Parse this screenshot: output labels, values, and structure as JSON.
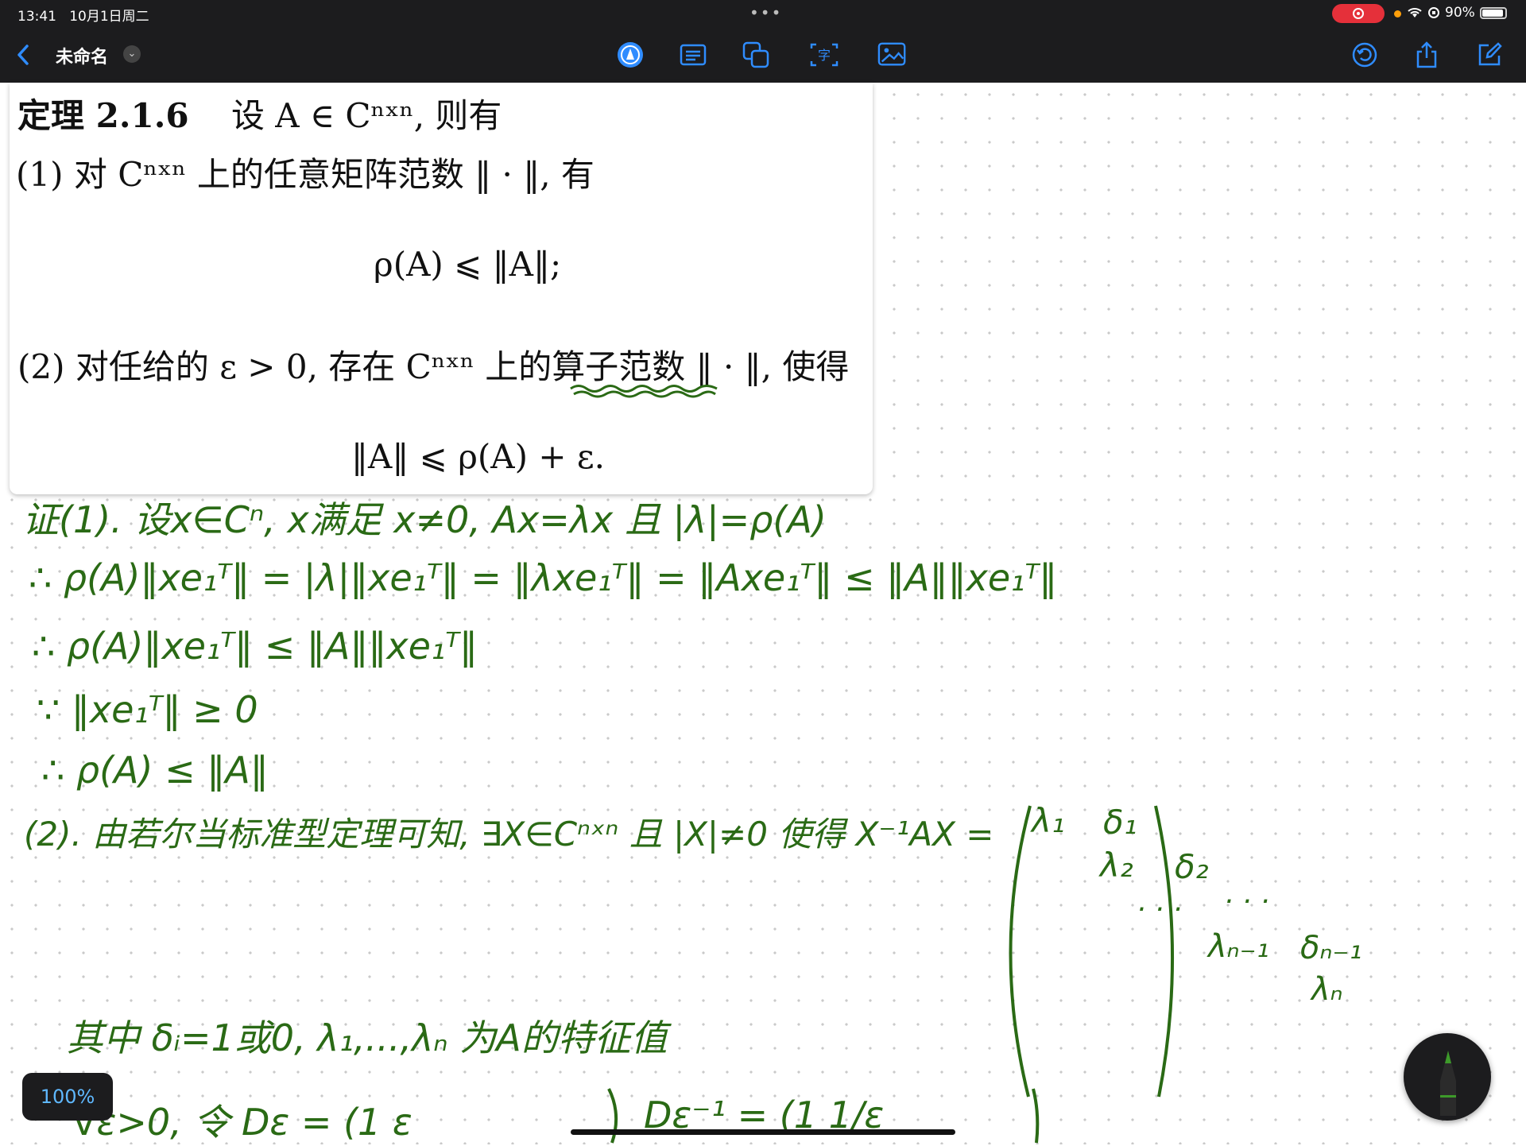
{
  "status": {
    "time": "13:41",
    "date": "10月1日周二",
    "battery": "90%"
  },
  "nav": {
    "title": "未命名",
    "icons": [
      "back-icon",
      "title-menu-icon",
      "pen-tool-icon",
      "text-box-icon",
      "shapes-icon",
      "text-recognition-icon",
      "image-icon",
      "undo-icon",
      "share-icon",
      "edit-icon"
    ]
  },
  "accent": "#2f8cff",
  "ink_color": "#2a6a15",
  "theorem": {
    "title": "定理 2.1.6",
    "intro": "设 A ∈ Cⁿˣⁿ, 则有",
    "item1": "(1) 对 Cⁿˣⁿ 上的任意矩阵范数 ‖ · ‖, 有",
    "formula1": "ρ(A) ⩽ ‖A‖;",
    "item2_pre": "(2) 对任给的 ε > 0, 存在 Cⁿˣⁿ 上的",
    "item2_mark": "算子范数",
    "item2_post": "‖ · ‖, 使得",
    "formula2": "‖A‖ ⩽ ρ(A) + ε."
  },
  "handwriting": {
    "l1": "证(1). 设x∈Cⁿ, x满足 x≠0, Ax=λx 且 |λ|=ρ(A)",
    "l2": "∴ ρ(A)‖xe₁ᵀ‖ = |λ|‖xe₁ᵀ‖ = ‖λxe₁ᵀ‖ = ‖Axe₁ᵀ‖ ≤ ‖A‖‖xe₁ᵀ‖",
    "l3": "∴ ρ(A)‖xe₁ᵀ‖ ≤ ‖A‖‖xe₁ᵀ‖",
    "l4": "∵ ‖xe₁ᵀ‖ ≥ 0",
    "l5": "∴ ρ(A) ≤ ‖A‖",
    "l6": "(2). 由若尔当标准型定理可知, ∃X∈Cⁿˣⁿ 且 |X|≠0 使得 X⁻¹AX =",
    "m_l1": "λ₁",
    "m_d1": "δ₁",
    "m_l2": "λ₂",
    "m_d2": "δ₂",
    "m_ln1": "λₙ₋₁",
    "m_dn1": "δₙ₋₁",
    "m_ln": "λₙ",
    "l7": "其中 δᵢ=1或0, λ₁,...,λₙ 为A的特征值",
    "l8": "∀ε>0, 令 Dε = (1  ε",
    "l9": "Dε⁻¹ = (1  1/ε"
  },
  "zoom": "100%"
}
